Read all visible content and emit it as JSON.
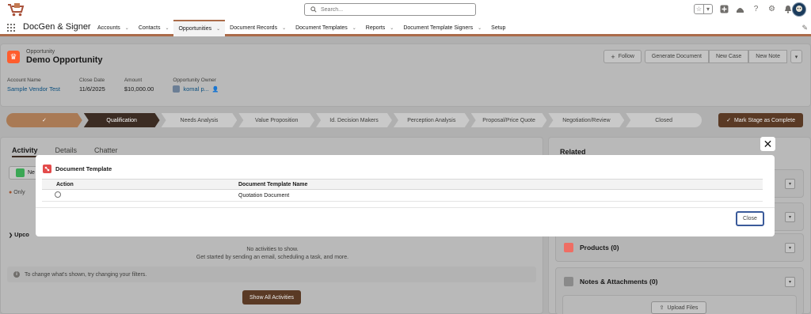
{
  "header": {
    "search_placeholder": "Search..."
  },
  "nav": {
    "app_name": "DocGen & Signer",
    "items": [
      {
        "label": "Accounts"
      },
      {
        "label": "Contacts"
      },
      {
        "label": "Opportunities"
      },
      {
        "label": "Document Records"
      },
      {
        "label": "Document Templates"
      },
      {
        "label": "Reports"
      },
      {
        "label": "Document Template Signers"
      },
      {
        "label": "Setup"
      }
    ],
    "active_index": 2
  },
  "record": {
    "type_label": "Opportunity",
    "title": "Demo Opportunity",
    "actions": {
      "follow": "Follow",
      "generate": "Generate Document",
      "new_case": "New Case",
      "new_note": "New Note"
    },
    "fields": [
      {
        "label": "Account Name",
        "value": "Sample Vendor Test",
        "link": true
      },
      {
        "label": "Close Date",
        "value": "11/6/2025",
        "link": false
      },
      {
        "label": "Amount",
        "value": "$10,000.00",
        "link": false
      },
      {
        "label": "Opportunity Owner",
        "value": "komal p...",
        "link": true
      }
    ]
  },
  "path": {
    "stages": [
      "",
      "Qualification",
      "Needs Analysis",
      "Value Proposition",
      "Id. Decision Makers",
      "Perception Analysis",
      "Proposal/Price Quote",
      "Negotiation/Review",
      "Closed"
    ],
    "mark_button": "Mark Stage as Complete"
  },
  "activity": {
    "tabs": [
      "Activity",
      "Details",
      "Chatter"
    ],
    "new_task_label": "Ne",
    "only_show": "Only",
    "upcoming": "Upco",
    "no_activities_1": "No activities to show.",
    "no_activities_2": "Get started by sending an email, scheduling a task, and more.",
    "filter_hint": "To change what's shown, try changing your filters.",
    "show_all": "Show All Activities"
  },
  "related": {
    "title": "Related",
    "products": "Products (0)",
    "notes": "Notes & Attachments (0)",
    "upload": "Upload Files"
  },
  "modal": {
    "title": "Document Template",
    "columns": [
      "Action",
      "Document Template Name"
    ],
    "rows": [
      {
        "name": "Quotation Document"
      }
    ],
    "close_label": "Close"
  },
  "colors": {
    "brand": "#ab6b49",
    "stage_current": "#3c2c23",
    "record_icon": "#ff5d2d"
  }
}
